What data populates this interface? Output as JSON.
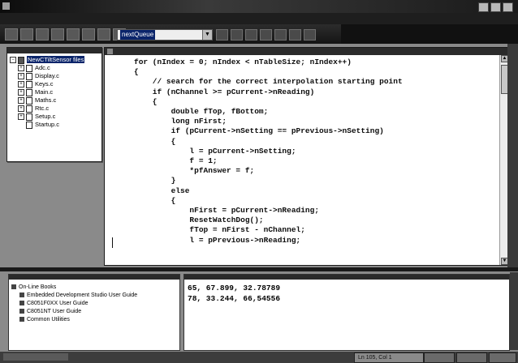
{
  "toolbar": {
    "function_combo": "nextQueue"
  },
  "workspace": {
    "root": "NewCTiltSensor files",
    "files": [
      {
        "name": "Adc.c",
        "expandable": true
      },
      {
        "name": "Display.c",
        "expandable": true
      },
      {
        "name": "Keys.c",
        "expandable": true
      },
      {
        "name": "Main.c",
        "expandable": true
      },
      {
        "name": "Maths.c",
        "expandable": true
      },
      {
        "name": "Rtc.c",
        "expandable": true
      },
      {
        "name": "Setup.c",
        "expandable": true
      },
      {
        "name": "Startup.c",
        "expandable": false
      }
    ]
  },
  "editor": {
    "code_lines": [
      "for (nIndex = 0; nIndex < nTableSize; nIndex++)",
      "{",
      "    // search for the correct interpolation starting point",
      "    if (nChannel >= pCurrent->nReading)",
      "    {",
      "        double fTop, fBottom;",
      "        long nFirst;",
      "        if (pCurrent->nSetting == pPrevious->nSetting)",
      "        {",
      "            l = pCurrent->nSetting;",
      "            f = 1;",
      "            *pfAnswer = f;",
      "        }",
      "        else",
      "        {",
      "            nFirst = pCurrent->nReading;",
      "            ResetWatchDog();",
      "            fTop = nFirst - nChannel;",
      "            l = pPrevious->nReading;"
    ]
  },
  "books": {
    "root": "On-Line Books",
    "items": [
      "Embedded Development Studio User Guide",
      "C8051F0XX User Guide",
      "C8051NT User Guide",
      "Common Utilities"
    ]
  },
  "output": {
    "lines": [
      "65, 67.899, 32.78789",
      "78, 33.244, 66,54556"
    ]
  },
  "status": {
    "position": "Ln 105, Col 1"
  }
}
